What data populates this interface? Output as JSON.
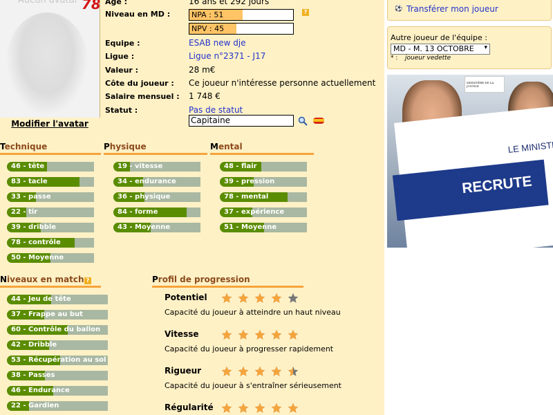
{
  "avatar": {
    "title": "Aucun avatar",
    "number": "78",
    "modify_label": "Modifier l'avatar"
  },
  "info": {
    "age_label": "Age :",
    "age_value": "16 ans et 292 jours",
    "niveau_label": "Niveau en MD :",
    "npa_label": "NPA : 51",
    "npa_level": 0.51,
    "npv_label": "NPV : 45",
    "npv_level": 0.45,
    "equipe_label": "Equipe :",
    "equipe_value": "ESAB new dje",
    "ligue_label": "Ligue :",
    "ligue_value": "Ligue n°2371 - J17",
    "valeur_label": "Valeur :",
    "valeur_value": "28 m€",
    "cote_label": "Côte du joueur :",
    "cote_value": "Ce joueur n'intéresse personne actuellement",
    "salaire_label": "Salaire mensuel :",
    "salaire_value": "1 748 €",
    "statut_label": "Statut :",
    "statut_value": "Pas de statut",
    "capitaine_value": "Capitaine"
  },
  "sections": {
    "technique": {
      "first": "T",
      "rest": "echnique",
      "skills": [
        {
          "label": "46 - tête",
          "level": 0.46
        },
        {
          "label": "83 - tacle",
          "level": 0.83
        },
        {
          "label": "33 - passe",
          "level": 0.33
        },
        {
          "label": "22 - tir",
          "level": 0.22
        },
        {
          "label": "39 - dribble",
          "level": 0.39
        },
        {
          "label": "78 - contrôle",
          "level": 0.78
        },
        {
          "label": "50 - Moyenne",
          "level": 0.5
        }
      ]
    },
    "physique": {
      "first": "P",
      "rest": "hysique",
      "skills": [
        {
          "label": "19 - vitesse",
          "level": 0.19
        },
        {
          "label": "34 - endurance",
          "level": 0.34
        },
        {
          "label": "36 - physique",
          "level": 0.36
        },
        {
          "label": "84 - forme",
          "level": 0.84
        },
        {
          "label": "43 - Moyenne",
          "level": 0.43
        }
      ]
    },
    "mental": {
      "first": "M",
      "rest": "ental",
      "skills": [
        {
          "label": "48 - flair",
          "level": 0.48
        },
        {
          "label": "39 - pression",
          "level": 0.39
        },
        {
          "label": "78 - mental",
          "level": 0.78
        },
        {
          "label": "37 - expérience",
          "level": 0.37
        },
        {
          "label": "51 - Moyenne",
          "level": 0.51
        }
      ]
    },
    "niveaux": {
      "first": "N",
      "rest": "iveaux en match",
      "skills": [
        {
          "label": "44 - Jeu de tête",
          "level": 0.44
        },
        {
          "label": "37 - Frappe au but",
          "level": 0.37
        },
        {
          "label": "60 - Contrôle du ballon",
          "level": 0.6
        },
        {
          "label": "42 - Dribble",
          "level": 0.42
        },
        {
          "label": "53 - Récupération au sol",
          "level": 0.53
        },
        {
          "label": "38 - Passes",
          "level": 0.38
        },
        {
          "label": "46 - Endurance",
          "level": 0.46
        },
        {
          "label": "22 - Gardien",
          "level": 0.22
        }
      ]
    },
    "profil": {
      "first": "P",
      "rest": "rofil de progression",
      "items": [
        {
          "title": "Potentiel",
          "desc": "Capacité du joueur à atteindre un haut niveau",
          "stars": 4
        },
        {
          "title": "Vitesse",
          "desc": "Capacité du joueur à progresser rapidement",
          "stars": 5
        },
        {
          "title": "Rigueur",
          "desc": "Capacité du joueur à s'entraîner sérieusement",
          "stars": 4.5
        },
        {
          "title": "Régularité",
          "desc": "",
          "stars": 5
        }
      ]
    }
  },
  "right": {
    "transfer_label": "Transférer mon joueur",
    "other_player_label": "Autre joueur de l'équipe :",
    "other_player_selected": "MD - M. 13 OCTOBRE",
    "note_star": "* :",
    "note_text": "joueur vedette",
    "ad_line1": "LE MINISTÈ",
    "ad_line2": "RECRUTE",
    "ad_logo": "MINISTÈRE DE LA JUSTICE"
  },
  "colors": {
    "accent": "#f5a43c",
    "skill_fill": "#5a8c00",
    "skill_bg": "#a9b8a2",
    "star": "#f5a43c",
    "star_empty": "#777777"
  }
}
